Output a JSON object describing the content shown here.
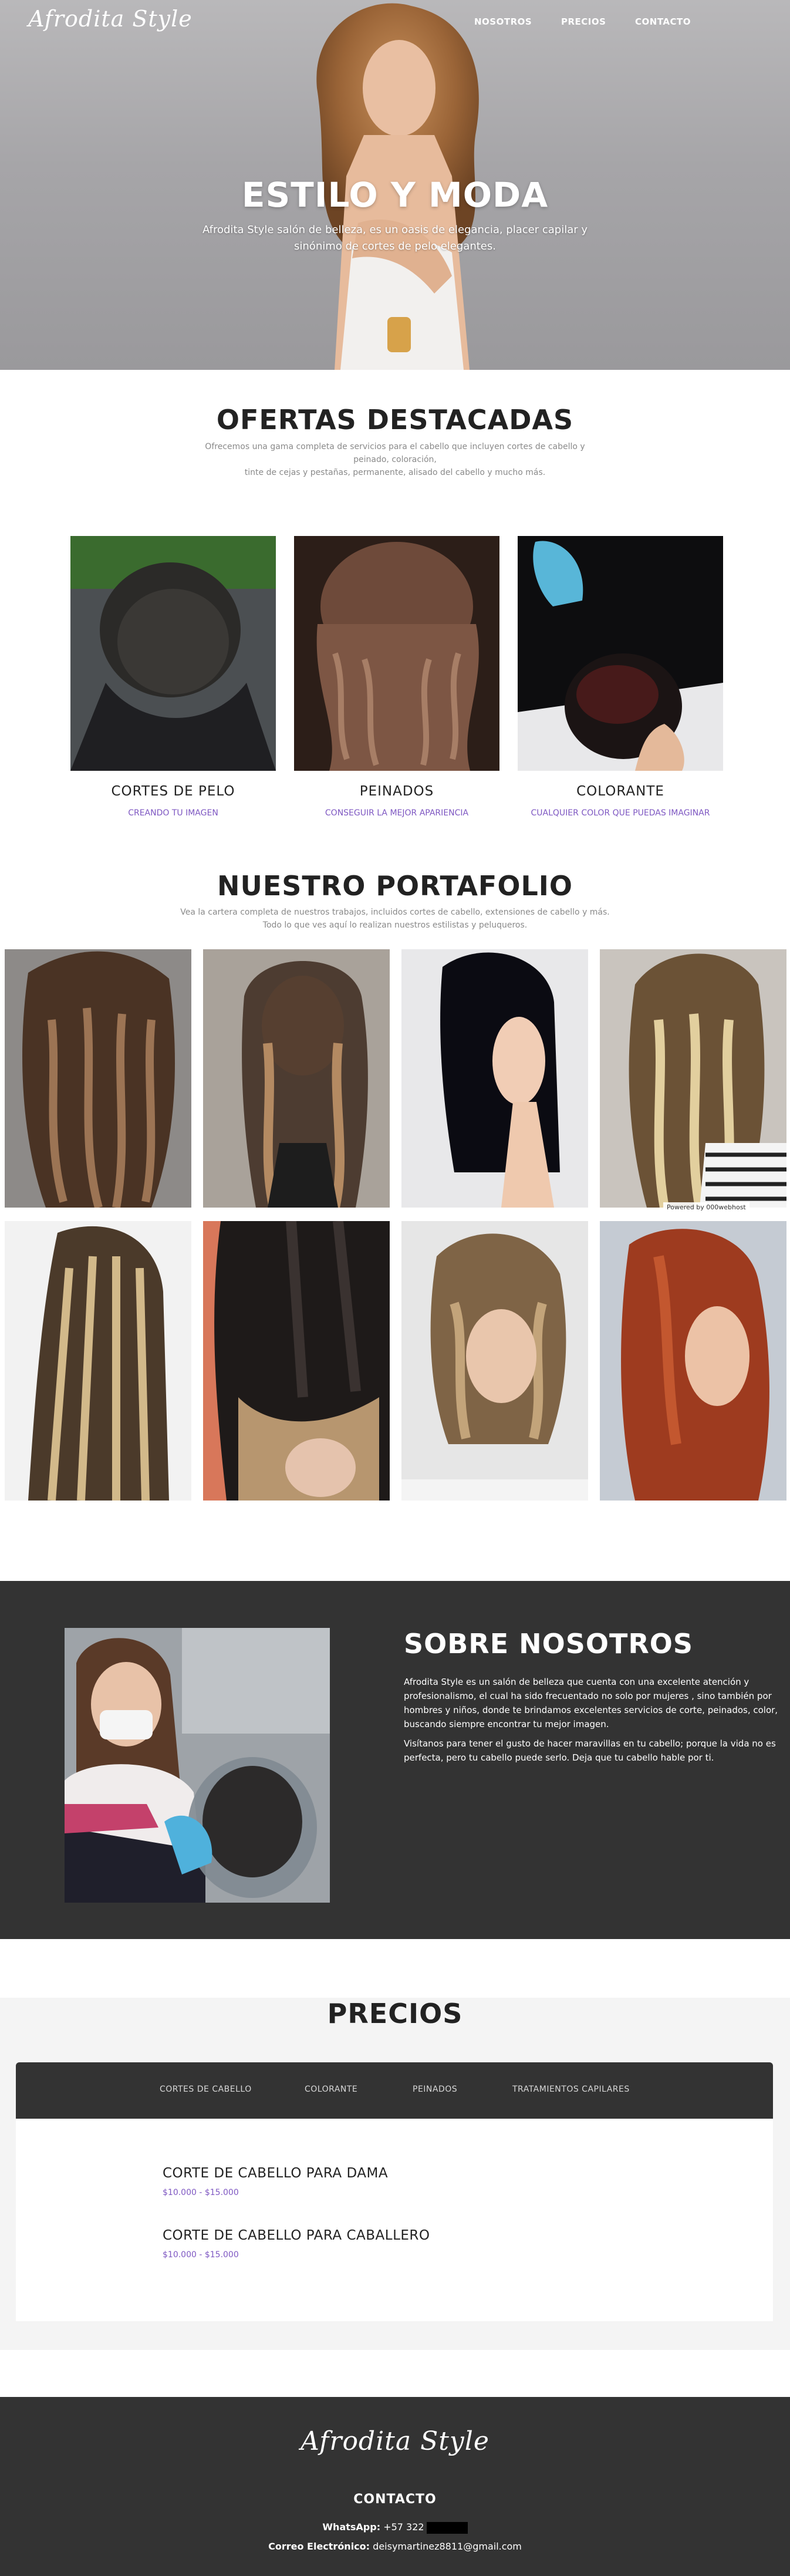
{
  "brand": {
    "logo": "Afrodita Style"
  },
  "nav": {
    "items": [
      "NOSOTROS",
      "PRECIOS",
      "CONTACTO"
    ]
  },
  "hero": {
    "title": "ESTILO Y MODA",
    "subtitle": "Afrodita Style salón de belleza, es un oasis de elegancia, placer capilar y sinónimo de cortes de pelo elegantes."
  },
  "offers": {
    "title": "OFERTAS DESTACADAS",
    "description_1": "Ofrecemos una gama completa de servicios para el cabello que incluyen cortes de cabello y peinado, coloración,",
    "description_2": "tinte de cejas y pestañas, permanente, alisado del cabello y mucho más.",
    "items": [
      {
        "name": "CORTES DE PELO",
        "link": "CREANDO TU IMAGEN"
      },
      {
        "name": "PEINADOS",
        "link": "CONSEGUIR LA MEJOR APARIENCIA"
      },
      {
        "name": "COLORANTE",
        "link": "CUALQUIER COLOR QUE PUEDAS IMAGINAR"
      }
    ]
  },
  "portfolio": {
    "title": "NUESTRO PORTAFOLIO",
    "description": "Vea la cartera completa de nuestros trabajos, incluidos cortes de cabello, extensiones de cabello y más. Todo lo que ves aquí lo realizan nuestros estilistas y peluqueros.",
    "powered_by": "Powered by  000webhost"
  },
  "about": {
    "title": "SOBRE NOSOTROS",
    "paragraph_1": "Afrodita Style es un salón de belleza que cuenta con una excelente atención y profesionalismo, el cual ha sido frecuentado no solo por mujeres , sino también por hombres y niños, donde te brindamos excelentes servicios de corte, peinados, color, buscando siempre encontrar tu mejor imagen.",
    "paragraph_2": "Visítanos para tener el gusto de hacer maravillas en tu cabello; porque la vida no es perfecta, pero tu cabello puede serlo. Deja que tu cabello hable por ti."
  },
  "prices": {
    "title": "PRECIOS",
    "tabs": [
      "CORTES DE CABELLO",
      "COLORANTE",
      "PEINADOS",
      "TRATAMIENTOS CAPILARES"
    ],
    "items": [
      {
        "name": "CORTE DE CABELLO PARA DAMA",
        "price": "$10.000 - $15.000"
      },
      {
        "name": "CORTE DE CABELLO PARA CABALLERO",
        "price": "$10.000 - $15.000"
      }
    ]
  },
  "footer": {
    "logo": "Afrodita Style",
    "contact_title": "CONTACTO",
    "whatsapp_label": "WhatsApp:",
    "whatsapp_value": "+57 322",
    "email_label": "Correo Electrónico:",
    "email_value": "deisymartinez8811@gmail.com"
  },
  "colors": {
    "dark": "#333333",
    "accent": "#7e57c2",
    "light_bg": "#f4f4f4"
  }
}
